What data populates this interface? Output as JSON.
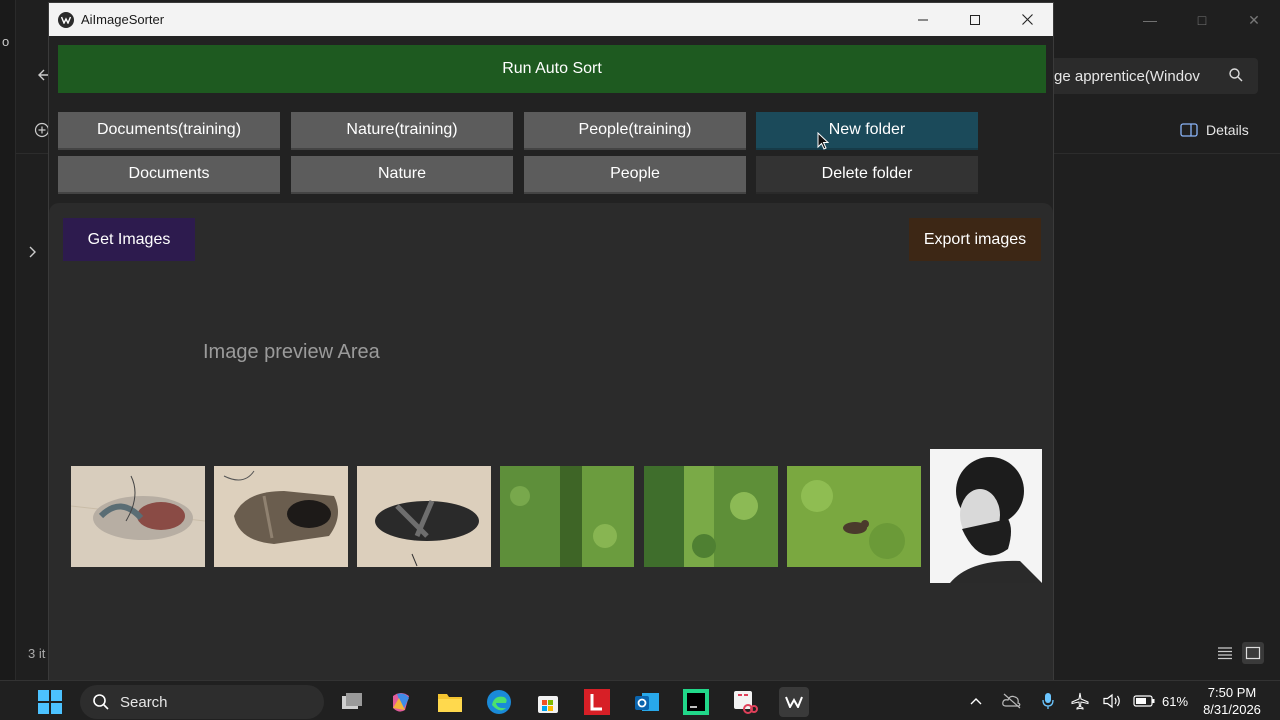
{
  "background_window": {
    "search_text": "ge apprentice(Windov",
    "details_label": "Details",
    "status_left": "3 it",
    "cut_text": "o"
  },
  "app": {
    "title": "AiImageSorter",
    "run_button": "Run Auto Sort",
    "training_buttons": [
      "Documents(training)",
      "Nature(training)",
      "People(training)"
    ],
    "new_folder_button": "New folder",
    "folder_buttons": [
      "Documents",
      "Nature",
      "People"
    ],
    "delete_folder_button": "Delete folder",
    "get_images_button": "Get Images",
    "export_images_button": "Export images",
    "preview_label": "Image preview Area",
    "thumbnails": [
      {
        "icon": "shoe-thumbnail"
      },
      {
        "icon": "boot-thumbnail"
      },
      {
        "icon": "sandal-thumbnail"
      },
      {
        "icon": "grass-thumbnail"
      },
      {
        "icon": "grass-thumbnail"
      },
      {
        "icon": "cat-on-grass-thumbnail"
      },
      {
        "icon": "portrait-thumbnail"
      }
    ]
  },
  "taskbar": {
    "search_placeholder": "Search",
    "battery": "61%",
    "time": "7:50 PM",
    "date": "8/31/2026"
  },
  "colors": {
    "run_button": "#1e5a20",
    "new_folder": "#1b4a5a",
    "get_images": "#2d1b4e",
    "export_images": "#3d2715"
  }
}
